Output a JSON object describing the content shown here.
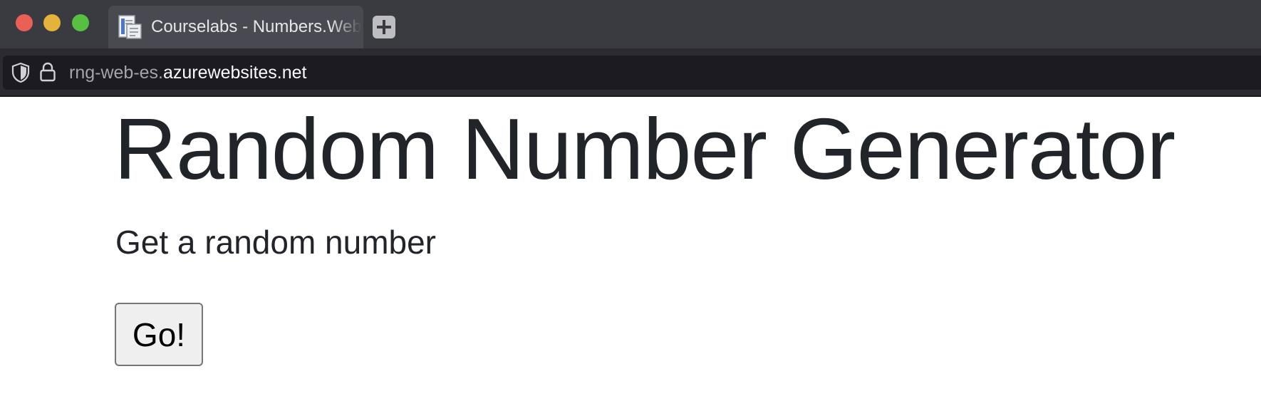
{
  "window": {
    "controls": [
      "close",
      "minimize",
      "maximize"
    ],
    "colors": {
      "close": "#ec5f57",
      "minimize": "#e5b23a",
      "maximize": "#57bf42"
    }
  },
  "tabs": [
    {
      "title": "Courselabs - Numbers.Web",
      "favicon": "document-icon",
      "active": true
    }
  ],
  "new_tab_icon": "plus-icon",
  "address_bar": {
    "security_icon": "shield-icon",
    "lock_icon": "lock-icon",
    "subdomain": "rng-web-es.",
    "domain": "azurewebsites.net"
  },
  "page": {
    "title": "Random Number Generator",
    "subtitle": "Get a random number",
    "button_label": "Go!"
  }
}
